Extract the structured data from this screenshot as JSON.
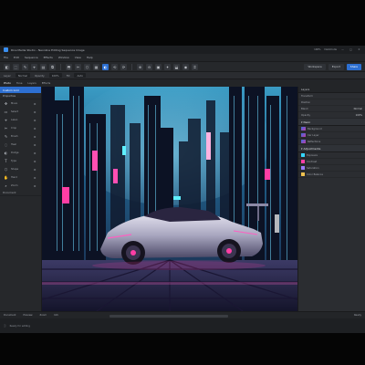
{
  "window": {
    "title": "Rice Media Studio - Neonline Editing Sequence Image",
    "right_info": [
      "100%",
      "Darkmode"
    ],
    "window_controls": [
      "—",
      "□",
      "✕"
    ]
  },
  "menubar": {
    "items": [
      "File",
      "Edit",
      "Sequence",
      "Effects",
      "Window",
      "View",
      "Help"
    ]
  },
  "toolbar": {
    "buttons": [
      "◧",
      "⬚",
      "✎",
      "⌖",
      "▤",
      "⧉",
      "⬒",
      "✂",
      "⬡",
      "▦",
      "◐",
      "⟲",
      "⟳",
      "⊕",
      "⊖",
      "▣",
      "✦",
      "⬓",
      "◉",
      "⌗"
    ],
    "active_index": 10,
    "pills": [
      "Workspace",
      "Export",
      "Share"
    ]
  },
  "optionbar": {
    "items": [
      "Layer",
      "Normal",
      "Opacity",
      "100%",
      "Fill",
      "Auto"
    ]
  },
  "tabs": {
    "items": [
      "Photo",
      "Tone",
      "Layers",
      "Effects"
    ],
    "active_index": 0
  },
  "left_panel": {
    "active_label": "Custom Grid",
    "section": "Properties",
    "tools": [
      {
        "icon": "✥",
        "label": "Move"
      },
      {
        "icon": "▭",
        "label": "Select"
      },
      {
        "icon": "⌖",
        "label": "Lasso"
      },
      {
        "icon": "✂",
        "label": "Crop"
      },
      {
        "icon": "✎",
        "label": "Brush"
      },
      {
        "icon": "◌",
        "label": "Heal"
      },
      {
        "icon": "◐",
        "label": "Dodge"
      },
      {
        "icon": "T",
        "label": "Type"
      },
      {
        "icon": "⬡",
        "label": "Shape"
      },
      {
        "icon": "✋",
        "label": "Hand"
      },
      {
        "icon": "⌕",
        "label": "Zoom"
      }
    ],
    "subsection": "Document"
  },
  "right_panel": {
    "header": "Layers",
    "rows": [
      {
        "label": "Transform",
        "value": ""
      },
      {
        "label": "Position",
        "value": ""
      },
      {
        "label": "Blend",
        "value": "Normal"
      },
      {
        "label": "Opacity",
        "value": "100%"
      }
    ],
    "section": "Neon",
    "layer_rows": [
      {
        "label": "Background",
        "value": ""
      },
      {
        "label": "Car Layer",
        "value": ""
      },
      {
        "label": "Reflections",
        "value": ""
      }
    ],
    "section2": "Adjustments",
    "adj_rows": [
      "Exposure",
      "Contrast",
      "Saturation",
      "Color Balance"
    ]
  },
  "statusbar": {
    "items": [
      "Document",
      "Preview",
      "Zoom",
      "Info"
    ],
    "right": "Ready"
  },
  "bottombar": {
    "label": "Ready for editing"
  },
  "colors": {
    "accent": "#2d6fd1",
    "neon_pink": "#ff3ea5",
    "neon_blue": "#35d6ff",
    "sky_top": "#2b7fa8"
  }
}
